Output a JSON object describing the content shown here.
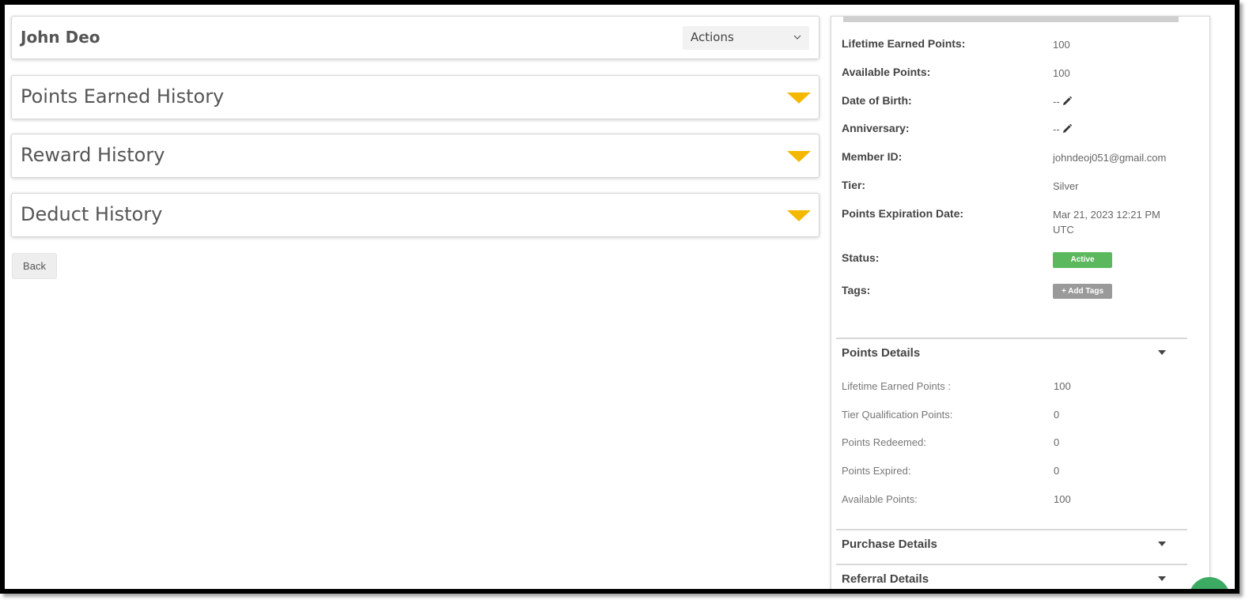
{
  "member": {
    "name": "John Deo",
    "actions_label": "Actions"
  },
  "accordions": [
    {
      "title": "Points Earned History"
    },
    {
      "title": "Reward History"
    },
    {
      "title": "Deduct History"
    }
  ],
  "back_label": "Back",
  "profile": {
    "rows": [
      {
        "label": "Lifetime Earned Points:",
        "value": "100"
      },
      {
        "label": "Available Points:",
        "value": "100"
      },
      {
        "label": "Date of Birth:",
        "value": "--"
      },
      {
        "label": "Anniversary:",
        "value": "--"
      },
      {
        "label": "Member ID:",
        "value": "johndeoj051@gmail.com"
      },
      {
        "label": "Tier:",
        "value": "Silver"
      },
      {
        "label": "Points Expiration Date:",
        "value": "Mar 21, 2023 12:21 PM UTC"
      }
    ],
    "status_label": "Status:",
    "status_value": "Active",
    "tags_label": "Tags:",
    "add_tags_label": "+ Add Tags"
  },
  "points_details": {
    "title": "Points Details",
    "rows": [
      {
        "label": "Lifetime Earned Points :",
        "value": "100"
      },
      {
        "label": "Tier Qualification Points:",
        "value": "0"
      },
      {
        "label": "Points Redeemed:",
        "value": "0"
      },
      {
        "label": "Points Expired:",
        "value": "0"
      },
      {
        "label": "Available Points:",
        "value": "100"
      }
    ]
  },
  "purchase_details": {
    "title": "Purchase Details"
  },
  "referral_details": {
    "title": "Referral Details"
  },
  "colors": {
    "accordion_arrow": "#f5b800",
    "status_active": "#5cb85c",
    "tag_button": "#9a9a9a",
    "chat_bubble": "#3daa64"
  },
  "icons": {
    "actions": "chevron-down-icon",
    "accordion": "triangle-down-icon",
    "edit": "pencil-icon",
    "section": "caret-down-icon",
    "scroll": "scroll-up-arrow-icon"
  }
}
